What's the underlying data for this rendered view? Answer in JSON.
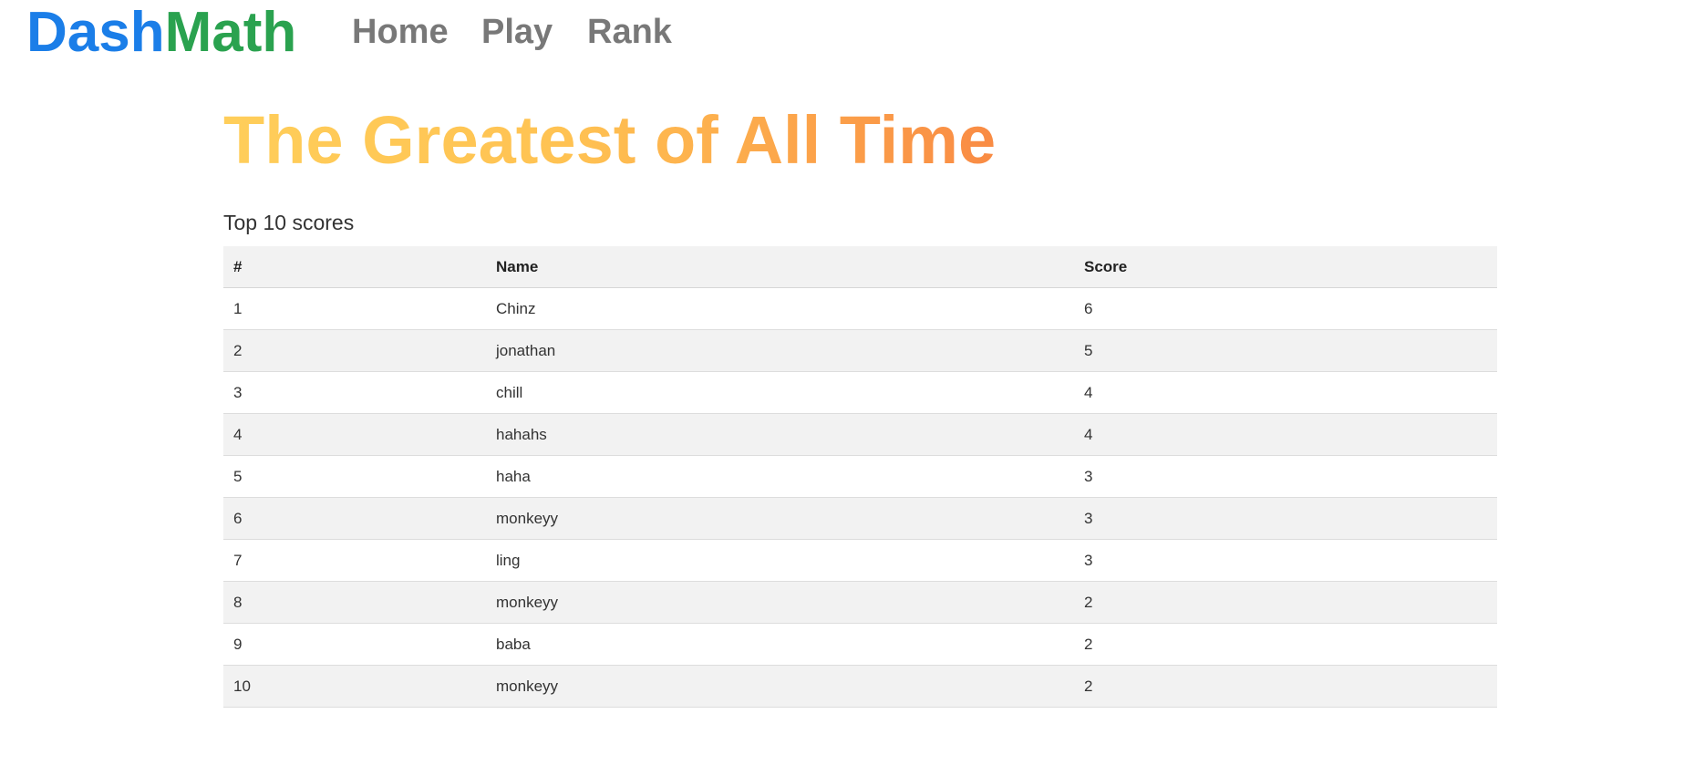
{
  "brand": {
    "part1": "Dash",
    "part2": "Math"
  },
  "nav": {
    "home": "Home",
    "play": "Play",
    "rank": "Rank"
  },
  "page": {
    "title": "The Greatest of All Time",
    "subtitle": "Top 10 scores"
  },
  "table": {
    "headers": [
      "#",
      "Name",
      "Score"
    ],
    "rows": [
      {
        "rank": "1",
        "name": "Chinz",
        "score": "6"
      },
      {
        "rank": "2",
        "name": "jonathan",
        "score": "5"
      },
      {
        "rank": "3",
        "name": "chill",
        "score": "4"
      },
      {
        "rank": "4",
        "name": "hahahs",
        "score": "4"
      },
      {
        "rank": "5",
        "name": "haha",
        "score": "3"
      },
      {
        "rank": "6",
        "name": "monkeyy",
        "score": "3"
      },
      {
        "rank": "7",
        "name": "ling",
        "score": "3"
      },
      {
        "rank": "8",
        "name": "monkeyy",
        "score": "2"
      },
      {
        "rank": "9",
        "name": "baba",
        "score": "2"
      },
      {
        "rank": "10",
        "name": "monkeyy",
        "score": "2"
      }
    ]
  },
  "colors": {
    "brand_blue": "#1b7ee8",
    "brand_green": "#2aa24f",
    "nav_text": "#787878",
    "title_gradient_start": "#ffce5a",
    "title_gradient_end": "#f98b44",
    "row_stripe": "#f2f2f2"
  }
}
